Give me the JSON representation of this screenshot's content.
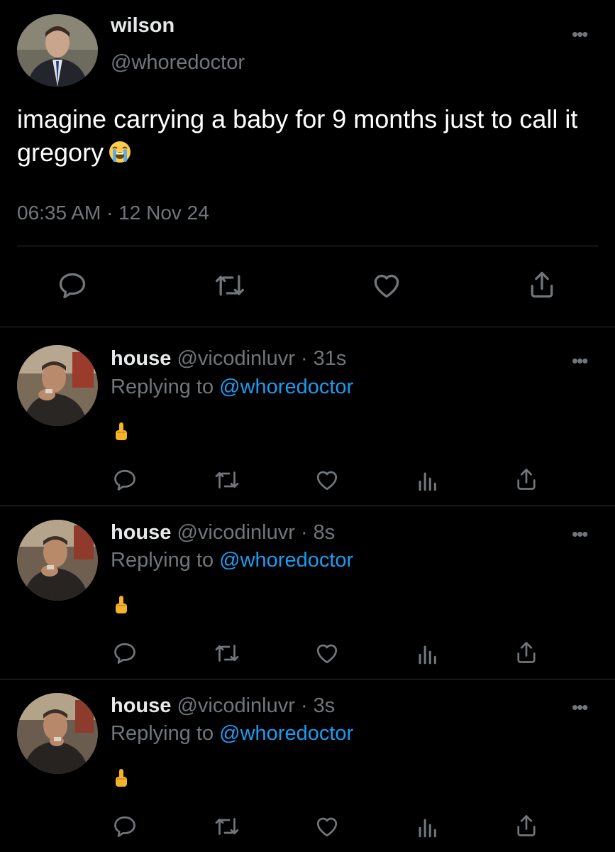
{
  "main_tweet": {
    "author_name": "wilson",
    "author_handle": "@whoredoctor",
    "text": "imagine carrying a baby for 9 months just to call it gregory",
    "emoji": "loudly-crying-face",
    "timestamp": "06:35 AM · 12 Nov 24",
    "actions": [
      "reply-icon",
      "retweet-icon",
      "like-icon",
      "share-icon"
    ]
  },
  "more_glyph": "•••",
  "replies": [
    {
      "name": "house",
      "meta": " @vicodinluvr · 31s",
      "replying_prefix": "Replying to ",
      "replying_handle": "@whoredoctor",
      "content_emoji": "middle-finger"
    },
    {
      "name": "house",
      "meta": " @vicodinluvr · 8s",
      "replying_prefix": "Replying to ",
      "replying_handle": "@whoredoctor",
      "content_emoji": "middle-finger"
    },
    {
      "name": "house",
      "meta": " @vicodinluvr · 3s",
      "replying_prefix": "Replying to ",
      "replying_handle": "@whoredoctor",
      "content_emoji": "middle-finger"
    }
  ],
  "reply_actions": [
    "reply-icon",
    "retweet-icon",
    "like-icon",
    "views-icon",
    "share-icon"
  ],
  "colors": {
    "background": "#000000",
    "text": "#e7e9ea",
    "secondary": "#71767b",
    "accent": "#1d9bf0",
    "divider": "#2f3336"
  }
}
